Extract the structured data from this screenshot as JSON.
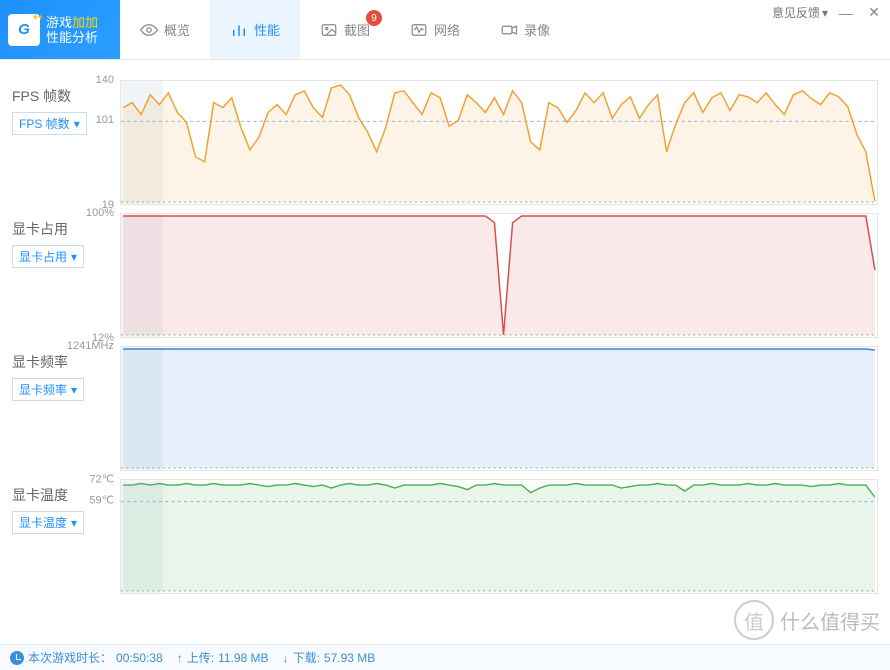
{
  "logo": {
    "line1_a": "游戏",
    "line1_b": "加加",
    "line2": "性能分析"
  },
  "tabs": {
    "overview": "概览",
    "performance": "性能",
    "screenshot": "截图",
    "network": "网络",
    "record": "录像",
    "screenshot_badge": "9"
  },
  "feedback": "意见反馈",
  "panels": {
    "fps": {
      "title": "FPS 帧数",
      "dd": "FPS 帧数",
      "ymax": "140",
      "ymid": "101",
      "ymin": "19"
    },
    "gpu_usage": {
      "title": "显卡占用",
      "dd": "显卡占用",
      "ymax": "100%",
      "ymin": "12%"
    },
    "gpu_clock": {
      "title": "显卡频率",
      "dd": "显卡频率",
      "ymax": "1241MHz"
    },
    "gpu_temp": {
      "title": "显卡温度",
      "dd": "显卡温度",
      "ymax": "72℃",
      "ymin": "59℃"
    }
  },
  "statusbar": {
    "session_label": "本次游戏时长：",
    "session_time": "00:50:38",
    "upload_label": "上传: ",
    "upload_val": "11.98 MB",
    "download_label": "下载: ",
    "download_val": "57.93 MB"
  },
  "watermark": "什么值得买",
  "chart_data": [
    {
      "type": "line",
      "name": "FPS 帧数",
      "ylabel": "FPS",
      "ylim": [
        19,
        140
      ],
      "ref_line": 101,
      "values": [
        115,
        120,
        108,
        128,
        118,
        130,
        110,
        100,
        65,
        60,
        120,
        115,
        125,
        95,
        72,
        85,
        110,
        118,
        108,
        128,
        132,
        115,
        105,
        135,
        138,
        128,
        105,
        90,
        70,
        95,
        130,
        132,
        120,
        108,
        130,
        125,
        96,
        102,
        128,
        120,
        110,
        125,
        108,
        132,
        120,
        80,
        72,
        120,
        115,
        100,
        112,
        130,
        120,
        130,
        104,
        118,
        126,
        104,
        118,
        128,
        70,
        98,
        120,
        130,
        110,
        125,
        130,
        112,
        128,
        126,
        120,
        130,
        118,
        108,
        128,
        132,
        124,
        118,
        130,
        126,
        116,
        88,
        70,
        20
      ],
      "color": "#f0a030"
    },
    {
      "type": "line",
      "name": "显卡占用",
      "ylabel": "%",
      "ylim": [
        12,
        100
      ],
      "values": [
        100,
        100,
        100,
        100,
        100,
        100,
        100,
        100,
        100,
        100,
        100,
        100,
        100,
        100,
        100,
        100,
        100,
        100,
        100,
        100,
        100,
        100,
        100,
        100,
        100,
        100,
        100,
        100,
        100,
        100,
        100,
        100,
        100,
        100,
        100,
        100,
        100,
        100,
        100,
        100,
        100,
        95,
        12,
        95,
        100,
        100,
        100,
        100,
        100,
        100,
        100,
        100,
        100,
        100,
        100,
        100,
        100,
        100,
        100,
        100,
        100,
        100,
        100,
        100,
        100,
        100,
        100,
        100,
        100,
        100,
        100,
        100,
        100,
        100,
        100,
        100,
        100,
        100,
        100,
        100,
        100,
        100,
        100,
        60
      ],
      "color": "#d94c4c"
    },
    {
      "type": "line",
      "name": "显卡频率",
      "ylabel": "MHz",
      "ylim": [
        0,
        1241
      ],
      "values": [
        1241,
        1241,
        1241,
        1241,
        1241,
        1241,
        1241,
        1241,
        1241,
        1241,
        1241,
        1241,
        1241,
        1241,
        1241,
        1241,
        1241,
        1241,
        1241,
        1241,
        1241,
        1241,
        1241,
        1241,
        1241,
        1241,
        1241,
        1241,
        1241,
        1241,
        1241,
        1241,
        1241,
        1241,
        1241,
        1241,
        1241,
        1241,
        1241,
        1241,
        1241,
        1241,
        1241,
        1241,
        1241,
        1241,
        1241,
        1241,
        1241,
        1241,
        1241,
        1241,
        1241,
        1241,
        1241,
        1241,
        1241,
        1241,
        1241,
        1241,
        1241,
        1241,
        1241,
        1241,
        1241,
        1241,
        1241,
        1241,
        1241,
        1241,
        1241,
        1241,
        1241,
        1241,
        1241,
        1241,
        1241,
        1241,
        1241,
        1241,
        1241,
        1241,
        1241,
        1230
      ],
      "color": "#3b82d6"
    },
    {
      "type": "line",
      "name": "显卡温度",
      "ylabel": "℃",
      "ylim": [
        0,
        72
      ],
      "ref_line": 59,
      "values": [
        70,
        70,
        71,
        70,
        71,
        70,
        70,
        71,
        70,
        70,
        71,
        70,
        70,
        70,
        71,
        70,
        69,
        70,
        70,
        71,
        70,
        69,
        70,
        68,
        70,
        71,
        70,
        70,
        71,
        70,
        68,
        70,
        70,
        70,
        70,
        71,
        70,
        69,
        67,
        70,
        70,
        71,
        70,
        70,
        70,
        65,
        68,
        70,
        70,
        70,
        71,
        70,
        70,
        70,
        70,
        68,
        69,
        70,
        70,
        71,
        70,
        70,
        66,
        70,
        70,
        71,
        70,
        70,
        70,
        71,
        70,
        70,
        71,
        70,
        70,
        70,
        69,
        70,
        70,
        71,
        70,
        70,
        70,
        62
      ],
      "color": "#4caf50"
    }
  ]
}
